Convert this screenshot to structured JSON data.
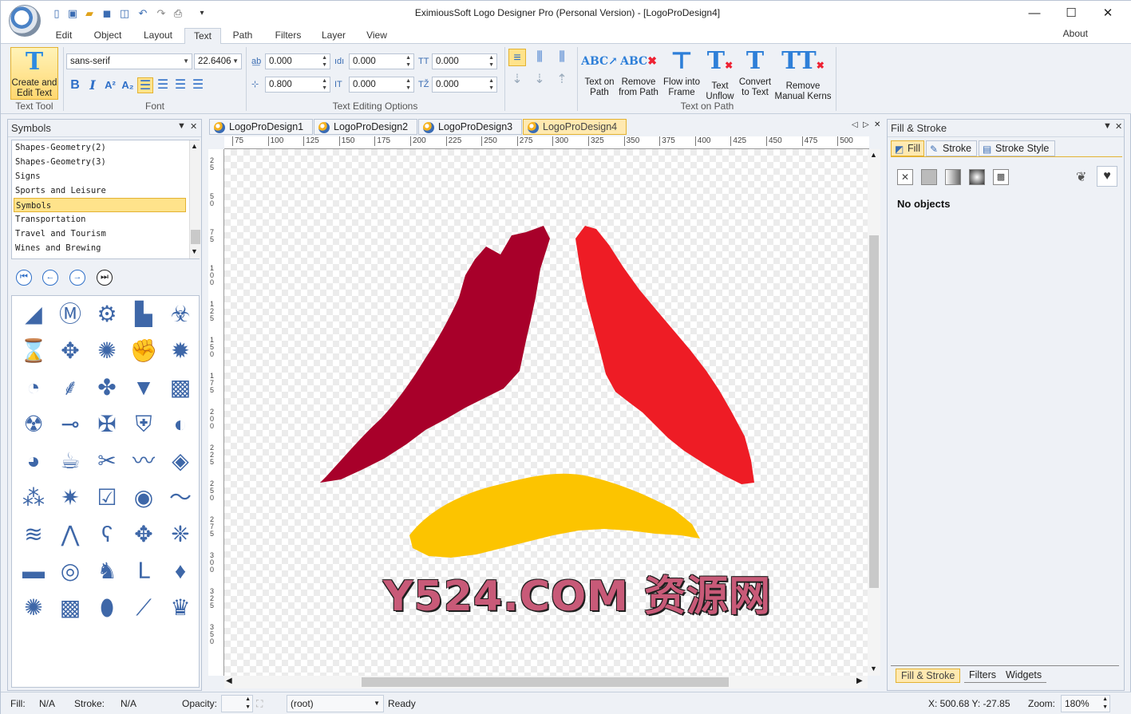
{
  "window": {
    "title": "EximiousSoft Logo Designer Pro (Personal Version) - [LogoProDesign4]",
    "minimize": "—",
    "maximize": "☐",
    "close": "✕"
  },
  "quick_access": [
    "new-icon",
    "open-icon",
    "open-folder-icon",
    "save-icon",
    "undo-icon",
    "redo-icon",
    "print-icon",
    "customize-icon"
  ],
  "menu": {
    "tabs": [
      "Edit",
      "Object",
      "Layout",
      "Text",
      "Path",
      "Filters",
      "Layer",
      "View"
    ],
    "active": "Text",
    "about": "About"
  },
  "ribbon": {
    "text_tool": {
      "button_label_1": "Create and",
      "button_label_2": "Edit Text",
      "group_label": "Text Tool"
    },
    "font": {
      "family": "sans-serif",
      "size": "22.6406",
      "group_label": "Font",
      "format_buttons": [
        "B",
        "I",
        "A²",
        "A₂"
      ],
      "align_icons": [
        "align-left-icon",
        "align-center-icon",
        "align-right-icon",
        "align-justify-icon"
      ]
    },
    "editing_options": {
      "group_label": "Text Editing Options",
      "fields": [
        "0.000",
        "0.000",
        "0.000",
        "0.800",
        "0.000",
        "0.000"
      ]
    },
    "text_on_path": {
      "group_label": "Text on Path",
      "buttons": [
        {
          "line1": "Text on",
          "line2": "Path"
        },
        {
          "line1": "Remove",
          "line2": "from Path"
        },
        {
          "line1": "Flow into",
          "line2": "Frame"
        },
        {
          "line1": "Text",
          "line2": "Unflow"
        },
        {
          "line1": "Convert",
          "line2": "to Text"
        },
        {
          "line1": "Remove",
          "line2": "Manual Kerns"
        }
      ]
    }
  },
  "symbols_panel": {
    "title": "Symbols",
    "categories": [
      "Shapes-Geometry(2)",
      "Shapes-Geometry(3)",
      "Signs",
      "Sports and Leisure",
      "Symbols",
      "Transportation",
      "Travel and Tourism",
      "Wines and Brewing"
    ],
    "selected": "Symbols",
    "nav": [
      "⏮",
      "←",
      "→",
      "⏭"
    ],
    "symbols": [
      "◢",
      "Ⓜ",
      "⚙",
      "▙",
      "☣",
      "⌛",
      "✥",
      "✺",
      "✊",
      "✹",
      "◔",
      "⸙",
      "✤",
      "▼",
      "▩",
      "☢",
      "⊸",
      "✠",
      "⛨",
      "◐",
      "◕",
      "☕",
      "✂",
      "〰",
      "◈",
      "⁂",
      "✷",
      "☑",
      "◉",
      "〜",
      "≋",
      "⋀",
      "ʕ",
      "✥",
      "❈",
      "▬",
      "◎",
      "♞",
      "ᒪ",
      "♦",
      "✺",
      "▩",
      "⬮",
      "⟋",
      "♛"
    ]
  },
  "documents": {
    "tabs": [
      "LogoProDesign1",
      "LogoProDesign2",
      "LogoProDesign3",
      "LogoProDesign4"
    ],
    "active": "LogoProDesign4",
    "hruler": [
      "75",
      "100",
      "125",
      "150",
      "175",
      "200",
      "225",
      "250",
      "275",
      "300",
      "325",
      "350",
      "375",
      "400",
      "425",
      "450",
      "475",
      "500"
    ],
    "vruler": [
      "25",
      "50",
      "75",
      "100",
      "125",
      "150",
      "175",
      "200",
      "225",
      "250",
      "275",
      "300",
      "325",
      "350"
    ]
  },
  "canvas": {
    "colors": {
      "dark_red": "#a8002a",
      "red": "#ee1c25",
      "yellow": "#fcc400"
    },
    "watermark": "Y524.COM 资源网"
  },
  "fill_panel": {
    "title": "Fill & Stroke",
    "tabs": [
      "Fill",
      "Stroke",
      "Stroke Style"
    ],
    "active_tab": "Fill",
    "modes": [
      "none-icon",
      "flat-color-icon",
      "linear-gradient-icon",
      "radial-gradient-icon",
      "pattern-icon"
    ],
    "message": "No objects",
    "bottom_tabs": [
      "Fill & Stroke",
      "Filters",
      "Widgets"
    ],
    "bottom_active": "Fill & Stroke"
  },
  "status": {
    "fill_label": "Fill:",
    "fill_value": "N/A",
    "stroke_label": "Stroke:",
    "stroke_value": "N/A",
    "opacity_label": "Opacity:",
    "layer": "(root)",
    "message": "Ready",
    "coords": "X: 500.68 Y: -27.85",
    "zoom_label": "Zoom:",
    "zoom_value": "180%"
  }
}
